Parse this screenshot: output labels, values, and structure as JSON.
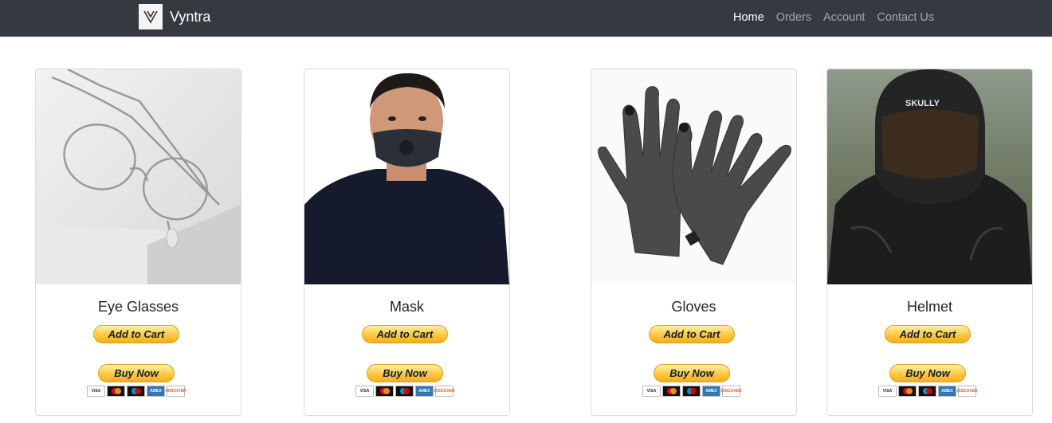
{
  "navbar": {
    "brand": "Vyntra",
    "links": [
      "Home",
      "Orders",
      "Account",
      "Contact Us"
    ],
    "active": "Home"
  },
  "products": [
    {
      "name": "Eye Glasses",
      "add_label": "Add to Cart",
      "buy_label": "Buy Now",
      "image": "eyeglasses-photo"
    },
    {
      "name": "Mask",
      "add_label": "Add to Cart",
      "buy_label": "Buy Now",
      "image": "face-mask-photo"
    },
    {
      "name": "Gloves",
      "add_label": "Add to Cart",
      "buy_label": "Buy Now",
      "image": "knit-gloves-photo"
    },
    {
      "name": "Helmet",
      "add_label": "Add to Cart",
      "buy_label": "Buy Now",
      "image": "motorcycle-helmet-photo"
    }
  ],
  "payment_icons": [
    "VISA",
    "mastercard",
    "maestro",
    "AMEX",
    "DISCOVER"
  ],
  "colors": {
    "navbar_bg": "#343a40",
    "paypal_yellow": "#ffc439"
  }
}
